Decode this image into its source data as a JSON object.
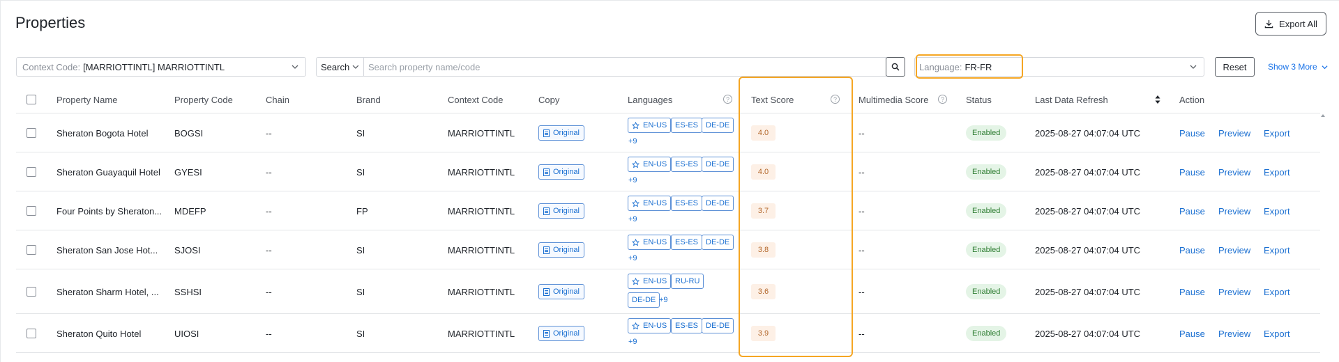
{
  "page": {
    "title": "Properties",
    "export_all_label": "Export All"
  },
  "filters": {
    "context_label": "Context Code:",
    "context_value": "[MARRIOTTINTL] MARRIOTTINTL",
    "search_type": "Search",
    "search_placeholder": "Search property name/code",
    "language_label": "Language:",
    "language_value": "FR-FR",
    "reset_label": "Reset",
    "show_more_label": "Show 3 More"
  },
  "columns": {
    "property_name": "Property Name",
    "property_code": "Property Code",
    "chain": "Chain",
    "brand": "Brand",
    "context_code": "Context Code",
    "copy": "Copy",
    "languages": "Languages",
    "text_score": "Text Score",
    "multimedia_score": "Multimedia Score",
    "status": "Status",
    "last_refresh": "Last Data Refresh",
    "action": "Action"
  },
  "actions": {
    "pause": "Pause",
    "preview": "Preview",
    "export": "Export"
  },
  "help_icon_glyph": "?",
  "rows": [
    {
      "name": "Sheraton Bogota Hotel",
      "code": "BOGSI",
      "chain": "--",
      "brand": "SI",
      "context": "MARRIOTTINTL",
      "copy": "Original",
      "langs": [
        "EN-US",
        "ES-ES",
        "DE-DE"
      ],
      "more": "+9",
      "text_score": "4.0",
      "multimedia": "--",
      "status": "Enabled",
      "refresh": "2025-08-27 04:07:04 UTC"
    },
    {
      "name": "Sheraton Guayaquil Hotel",
      "code": "GYESI",
      "chain": "--",
      "brand": "SI",
      "context": "MARRIOTTINTL",
      "copy": "Original",
      "langs": [
        "EN-US",
        "ES-ES",
        "DE-DE"
      ],
      "more": "+9",
      "text_score": "4.0",
      "multimedia": "--",
      "status": "Enabled",
      "refresh": "2025-08-27 04:07:04 UTC"
    },
    {
      "name": "Four Points by Sheraton...",
      "code": "MDEFP",
      "chain": "--",
      "brand": "FP",
      "context": "MARRIOTTINTL",
      "copy": "Original",
      "langs": [
        "EN-US",
        "ES-ES",
        "DE-DE"
      ],
      "more": "+9",
      "text_score": "3.7",
      "multimedia": "--",
      "status": "Enabled",
      "refresh": "2025-08-27 04:07:04 UTC"
    },
    {
      "name": "Sheraton San Jose Hot...",
      "code": "SJOSI",
      "chain": "--",
      "brand": "SI",
      "context": "MARRIOTTINTL",
      "copy": "Original",
      "langs": [
        "EN-US",
        "ES-ES",
        "DE-DE"
      ],
      "more": "+9",
      "text_score": "3.8",
      "multimedia": "--",
      "status": "Enabled",
      "refresh": "2025-08-27 04:07:04 UTC"
    },
    {
      "name": "Sheraton Sharm Hotel, ...",
      "code": "SSHSI",
      "chain": "--",
      "brand": "SI",
      "context": "MARRIOTTINTL",
      "copy": "Original",
      "langs": [
        "EN-US",
        "RU-RU",
        "DE-DE"
      ],
      "more": "+9",
      "text_score": "3.6",
      "multimedia": "--",
      "status": "Enabled",
      "refresh": "2025-08-27 04:07:04 UTC"
    },
    {
      "name": "Sheraton Quito Hotel",
      "code": "UIOSI",
      "chain": "--",
      "brand": "SI",
      "context": "MARRIOTTINTL",
      "copy": "Original",
      "langs": [
        "EN-US",
        "ES-ES",
        "DE-DE"
      ],
      "more": "+9",
      "text_score": "3.9",
      "multimedia": "--",
      "status": "Enabled",
      "refresh": "2025-08-27 04:07:04 UTC"
    }
  ],
  "colors": {
    "accent": "#1a6fd1",
    "highlight": "#f5a623",
    "score_bg": "#fdf0e6",
    "status_bg": "#e4f4e6"
  }
}
